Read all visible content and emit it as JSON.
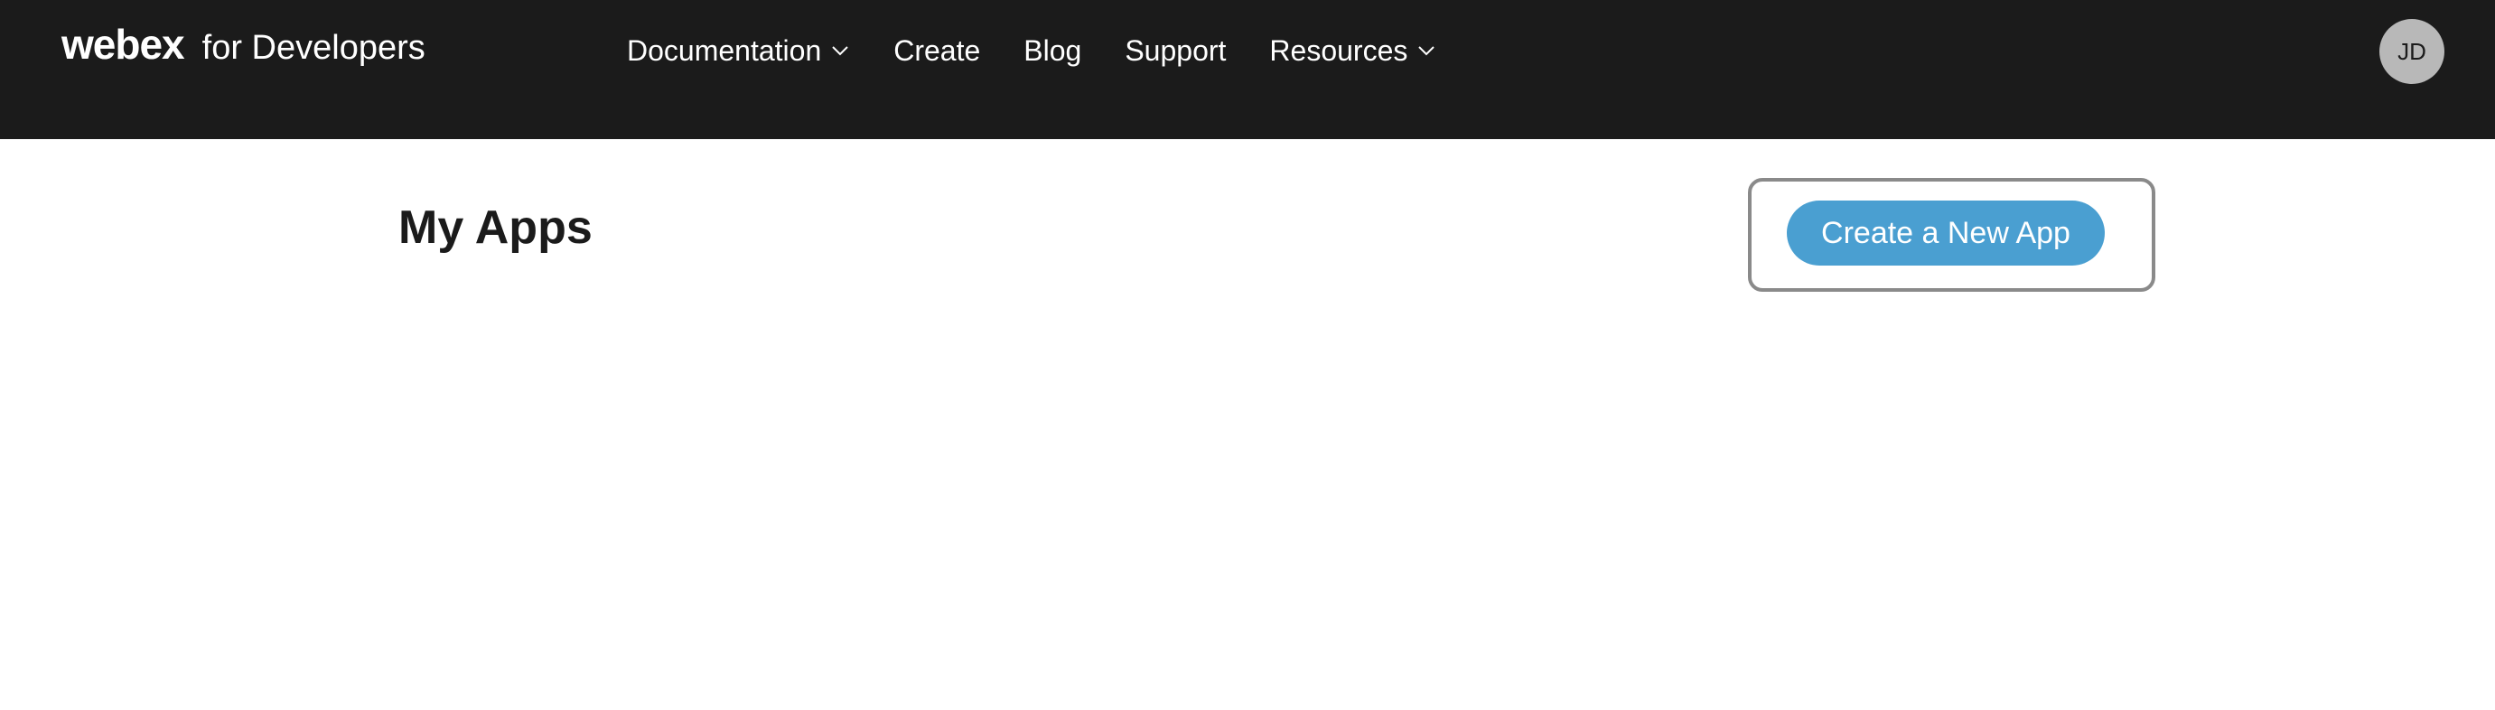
{
  "header": {
    "brand": {
      "wordmark": "webex",
      "suffix": "for Developers"
    },
    "nav": [
      {
        "label": "Documentation",
        "has_dropdown": true
      },
      {
        "label": "Create",
        "has_dropdown": false
      },
      {
        "label": "Blog",
        "has_dropdown": false
      },
      {
        "label": "Support",
        "has_dropdown": false
      },
      {
        "label": "Resources",
        "has_dropdown": true
      }
    ],
    "avatar_initials": "JD"
  },
  "main": {
    "title": "My Apps",
    "create_button_label": "Create a New App"
  },
  "colors": {
    "topbar": "#1b1b1b",
    "accent": "#4a9fd1",
    "avatar_bg": "#b8b8b8",
    "frame_border": "#8a8a8a"
  },
  "icons": {
    "dropdown": "chevron-down-icon"
  }
}
